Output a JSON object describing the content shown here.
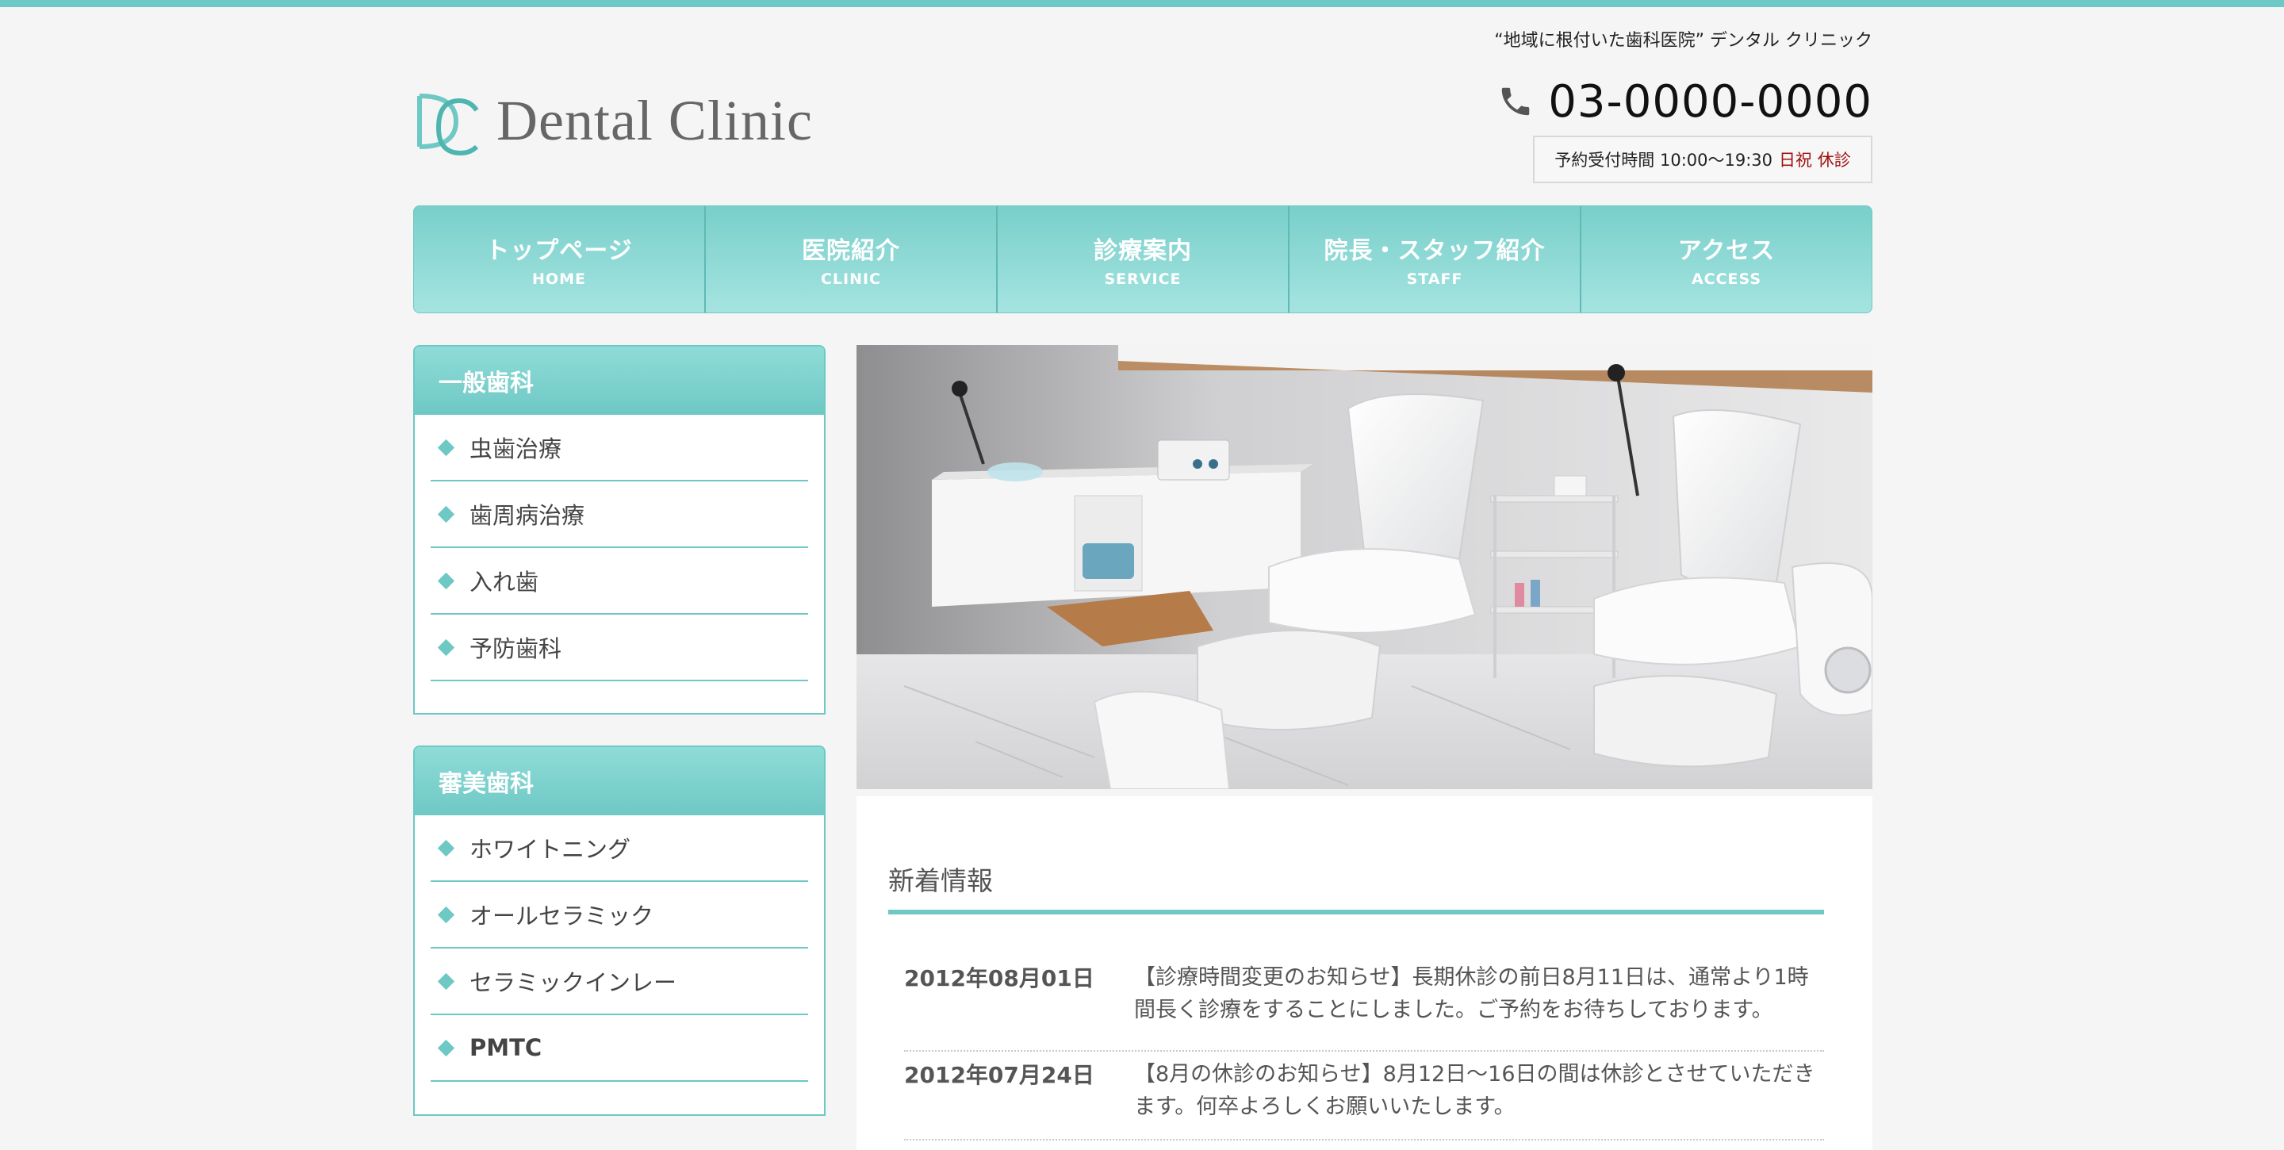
{
  "header": {
    "tagline": "“地域に根付いた歯科医院” デンタル クリニック",
    "logo_text": "Dental Clinic",
    "phone": "03-0000-0000",
    "hours_label": "予約受付時間 10:00〜19:30",
    "hours_closed": "日祝 休診"
  },
  "nav": [
    {
      "jp": "トップページ",
      "en": "HOME"
    },
    {
      "jp": "医院紹介",
      "en": "CLINIC"
    },
    {
      "jp": "診療案内",
      "en": "SERVICE"
    },
    {
      "jp": "院長・スタッフ紹介",
      "en": "STAFF"
    },
    {
      "jp": "アクセス",
      "en": "ACCESS"
    }
  ],
  "sidebar": [
    {
      "title": "一般歯科",
      "items": [
        "虫歯治療",
        "歯周病治療",
        "入れ歯",
        "予防歯科"
      ]
    },
    {
      "title": "審美歯科",
      "items": [
        "ホワイトニング",
        "オールセラミック",
        "セラミックインレー",
        "PMTC"
      ]
    }
  ],
  "news": {
    "title": "新着情報",
    "entries": [
      {
        "date": "2012年08月01日",
        "text": "【診療時間変更のお知らせ】長期休診の前日8月11日は、通常より1時間長く診療をすることにしました。ご予約をお待ちしております。"
      },
      {
        "date": "2012年07月24日",
        "text": "【8月の休診のお知らせ】8月12日〜16日の間は休診とさせていただきます。何卒よろしくお願いいたします。"
      }
    ]
  },
  "colors": {
    "accent": "#6ec8c4",
    "closed": "#a01010",
    "background": "#f5f5f5"
  }
}
